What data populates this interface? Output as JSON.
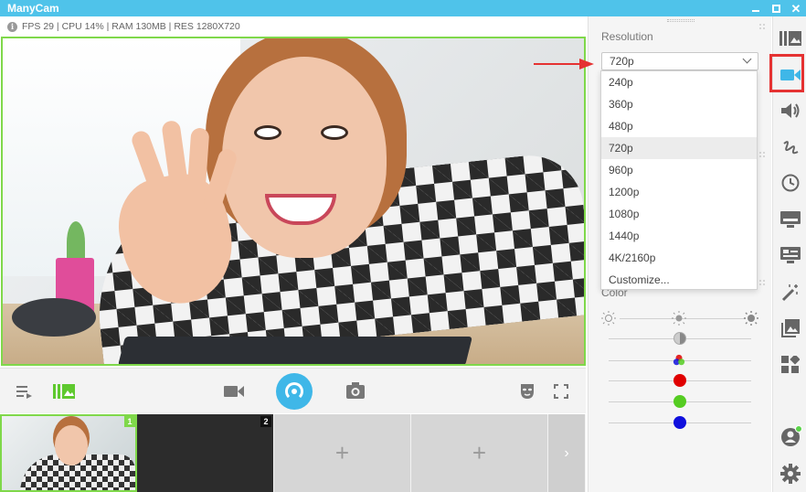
{
  "app": {
    "title": "ManyCam"
  },
  "status": {
    "info_icon": "i",
    "text": "FPS 29 | CPU 14% | RAM 130MB | RES 1280X720"
  },
  "controls": {
    "playlist_icon": "playlist-icon",
    "layers_icon": "layers-icon",
    "camera_icon": "camera-icon",
    "broadcast_icon": "broadcast-icon",
    "snapshot_icon": "snapshot-icon",
    "mask_icon": "mask-icon",
    "fullscreen_icon": "fullscreen-icon"
  },
  "thumbs": [
    {
      "number": "1",
      "kind": "camera"
    },
    {
      "number": "2",
      "kind": "noise"
    },
    {
      "add": "+"
    },
    {
      "add": "+"
    }
  ],
  "thumbs_more": "›",
  "panel": {
    "resolution_label": "Resolution",
    "selected": "720p",
    "options": [
      "240p",
      "360p",
      "480p",
      "720p",
      "960p",
      "1200p",
      "1080p",
      "1440p",
      "4K/2160p",
      "Customize..."
    ],
    "color_label": "Color"
  },
  "color_sliders": [
    {
      "name": "brightness",
      "color": "#cccccc"
    },
    {
      "name": "contrast",
      "color": "#d5d5d5"
    },
    {
      "name": "saturation",
      "color": "rgb"
    },
    {
      "name": "red",
      "color": "#e00000"
    },
    {
      "name": "green",
      "color": "#55cc22"
    },
    {
      "name": "blue",
      "color": "#1010dd"
    }
  ],
  "accent_color": "#3fb7e8",
  "sidebar": [
    "layers-icon",
    "video-source-icon",
    "audio-icon",
    "drawing-icon",
    "schedule-icon",
    "lower-thirds-icon",
    "presentation-icon",
    "effects-icon",
    "images-icon",
    "widgets-icon",
    "account-icon",
    "settings-icon"
  ]
}
